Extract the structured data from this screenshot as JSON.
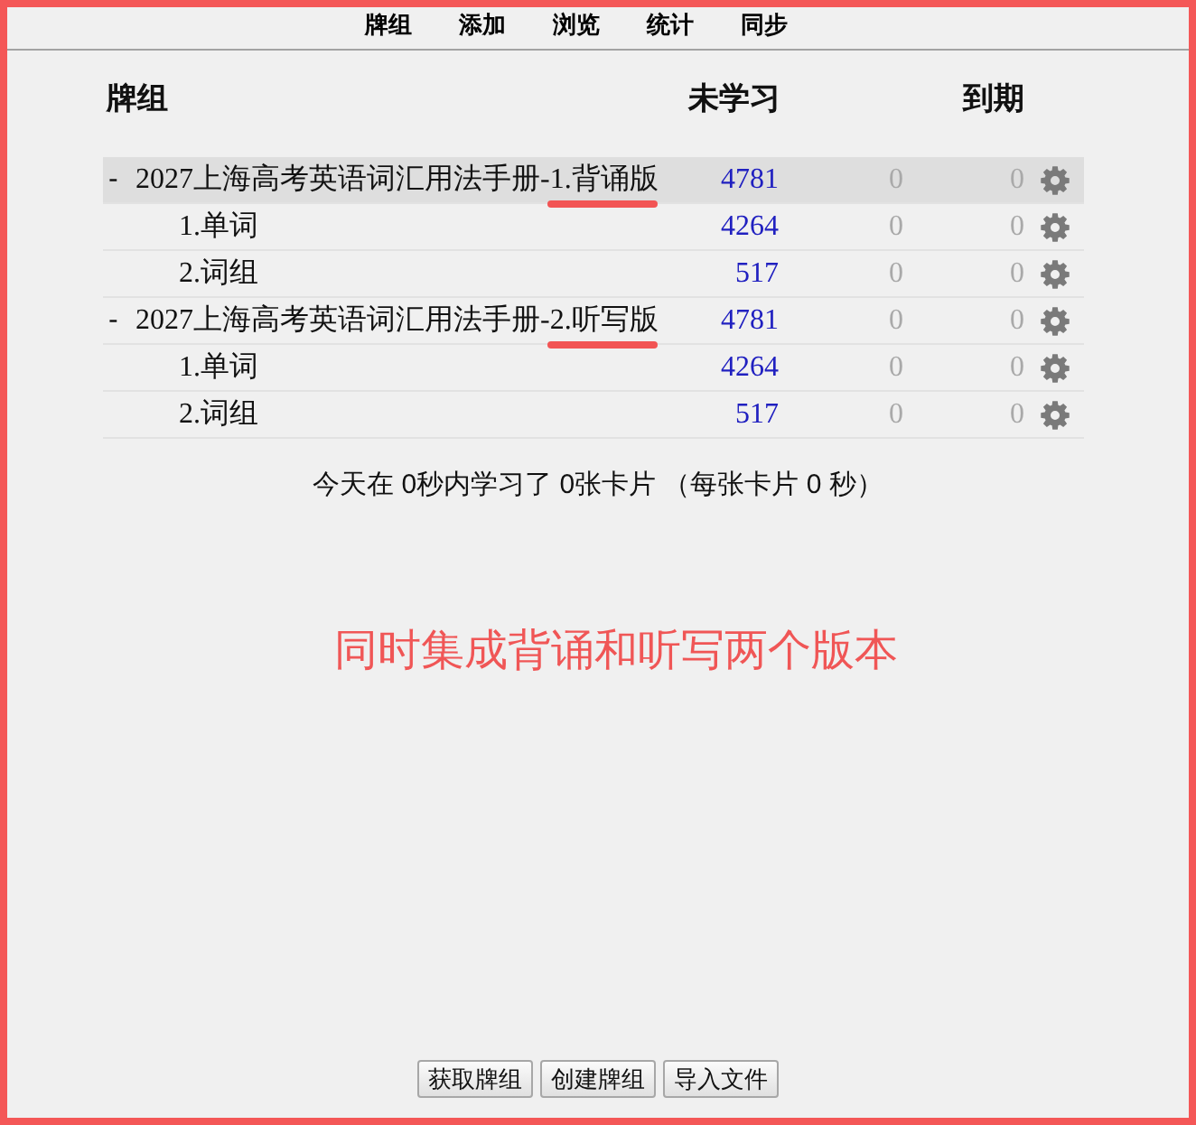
{
  "toolbar": {
    "items": [
      "牌组",
      "添加",
      "浏览",
      "统计",
      "同步"
    ]
  },
  "deck_table": {
    "columns": [
      "牌组",
      "未学习",
      "到期"
    ],
    "rows": [
      {
        "toggle": "-",
        "name": "2027上海高考英语词汇用法手册-",
        "edition": "1.背诵版",
        "edition_underlined": true,
        "selected": true,
        "new": "4781",
        "due": [
          {
            "text": "0",
            "dimmed": true
          },
          {
            "text": "0",
            "dimmed": true
          }
        ],
        "children": [
          {
            "name": "1.单词",
            "selected": false,
            "new": "4264",
            "due": [
              {
                "text": "0",
                "dimmed": true
              },
              {
                "text": "0",
                "dimmed": true
              }
            ]
          },
          {
            "name": "2.词组",
            "selected": false,
            "new": "517",
            "due": [
              {
                "text": "0",
                "dimmed": true
              },
              {
                "text": "0",
                "dimmed": true
              }
            ]
          }
        ]
      },
      {
        "toggle": "-",
        "name": "2027上海高考英语词汇用法手册-",
        "edition": "2.听写版",
        "edition_underlined": true,
        "selected": false,
        "new": "4781",
        "due": [
          {
            "text": "0",
            "dimmed": true
          },
          {
            "text": "0",
            "dimmed": true
          }
        ],
        "children": [
          {
            "name": "1.单词",
            "selected": false,
            "new": "4264",
            "due": [
              {
                "text": "0",
                "dimmed": true
              },
              {
                "text": "0",
                "dimmed": true
              }
            ]
          },
          {
            "name": "2.词组",
            "selected": false,
            "new": "517",
            "due": [
              {
                "text": "0",
                "dimmed": true
              },
              {
                "text": "0",
                "dimmed": true
              }
            ]
          }
        ]
      }
    ]
  },
  "stats": "今天在 0秒内学习了 0张卡片 （每张卡片 0 秒）",
  "annotation": {
    "caption": "同时集成背诵和听写两个版本"
  },
  "buttons": [
    "获取牌组",
    "创建牌组",
    "导入文件"
  ]
}
